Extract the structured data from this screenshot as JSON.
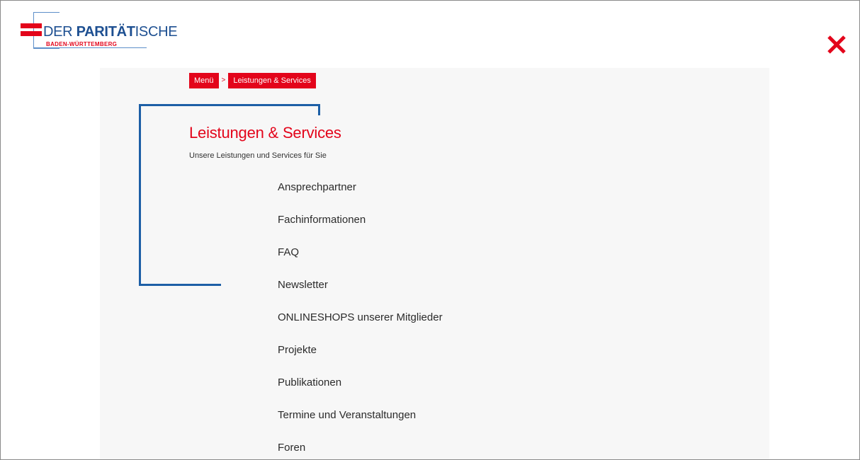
{
  "logo": {
    "brand_prefix": "DER ",
    "brand_strong": "PARITÄT",
    "brand_suffix": "ISCHE",
    "region": "BADEN-WÜRTTEMBERG"
  },
  "close": {
    "icon": "close-icon",
    "color": "#e3051b"
  },
  "breadcrumb": {
    "items": [
      {
        "label": "Menü"
      },
      {
        "label": "Leistungen & Services"
      }
    ],
    "separator": ">"
  },
  "section": {
    "title": "Leistungen & Services",
    "subtitle": "Unsere Leistungen und Services für Sie"
  },
  "menu": {
    "items": [
      {
        "label": "Ansprechpartner"
      },
      {
        "label": "Fachinformationen"
      },
      {
        "label": "FAQ"
      },
      {
        "label": "Newsletter"
      },
      {
        "label": "ONLINESHOPS unserer Mitglieder"
      },
      {
        "label": "Projekte"
      },
      {
        "label": "Publikationen"
      },
      {
        "label": "Termine und Veranstaltungen"
      },
      {
        "label": "Foren"
      }
    ]
  },
  "colors": {
    "brand_red": "#e3051b",
    "brand_blue": "#1d5fa6",
    "text": "#2b2b2b",
    "panel_background": "#f7f7f7"
  }
}
